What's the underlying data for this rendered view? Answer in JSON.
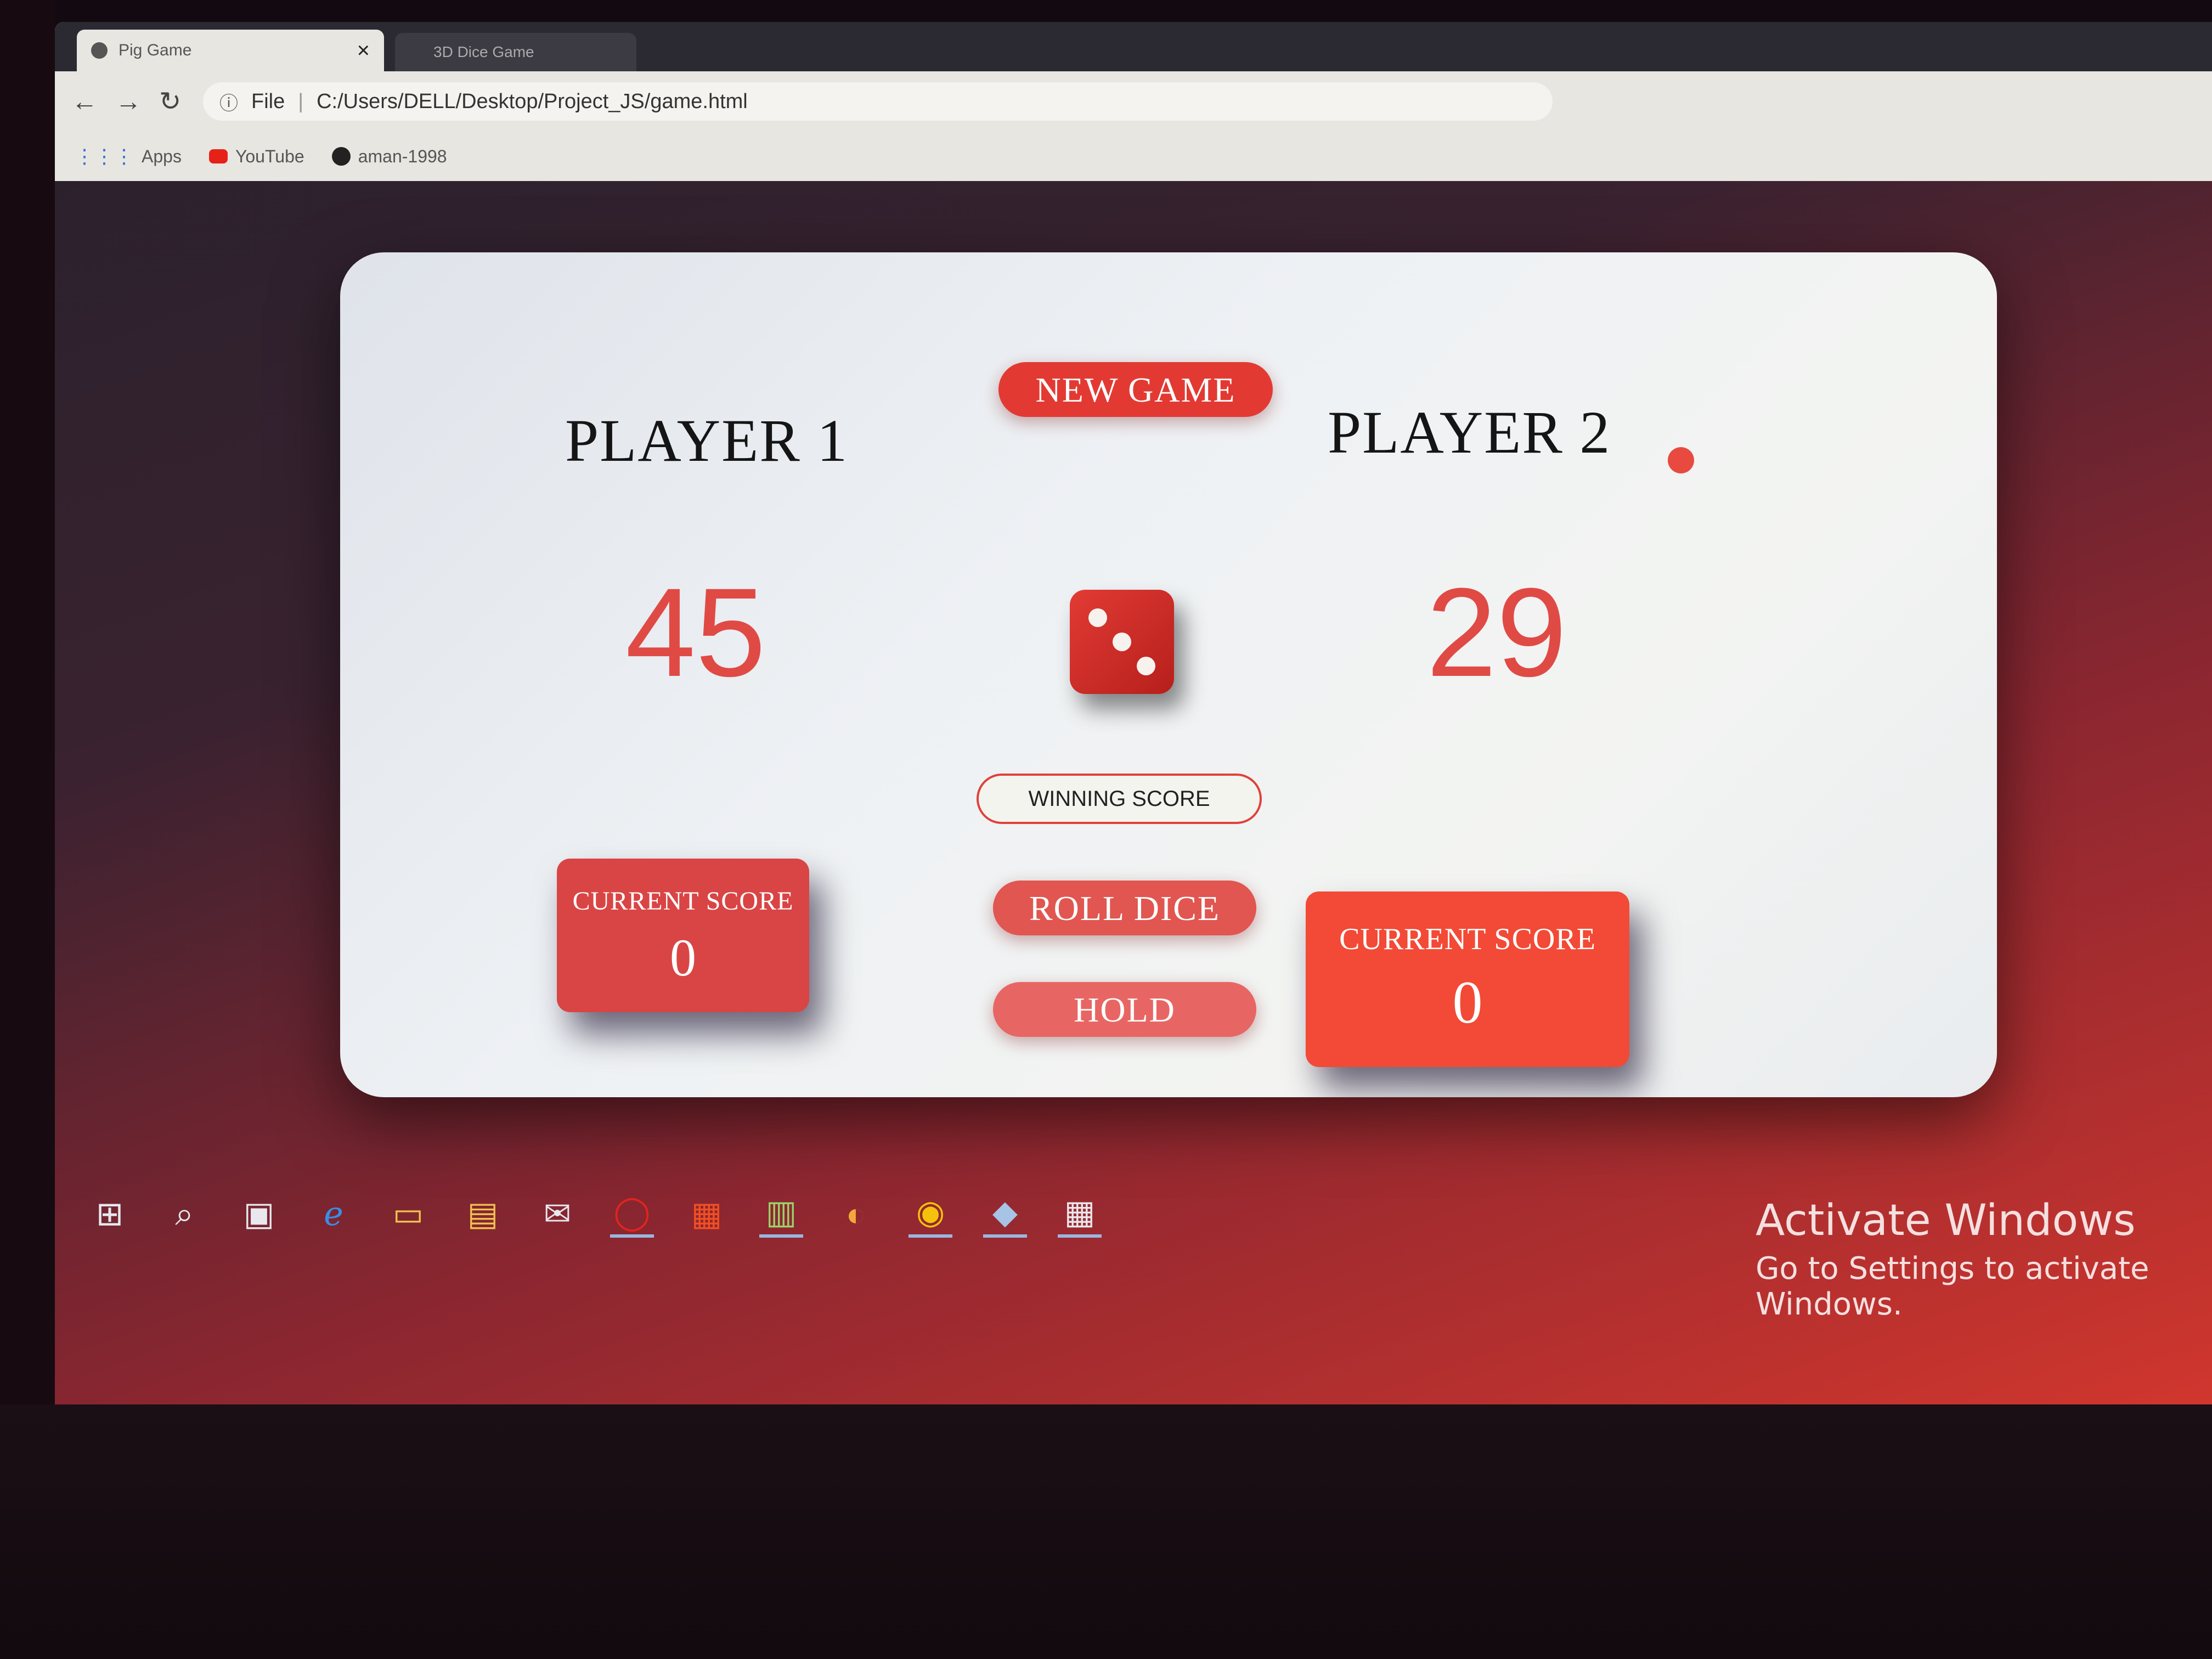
{
  "browser": {
    "tab_title": "Pig Game",
    "tab_close": "×",
    "second_tab_title": "3D Dice Game",
    "url_info": "ⓘ",
    "url_scheme": "File",
    "url_path": "C:/Users/DELL/Desktop/Project_JS/game.html",
    "bookmarks": [
      {
        "label": "Apps",
        "icon": "apps-grid-icon"
      },
      {
        "label": "YouTube",
        "icon": "youtube-icon"
      },
      {
        "label": "aman-1998",
        "icon": "github-icon"
      }
    ]
  },
  "game": {
    "new_game_label": "NEW GAME",
    "player1_name": "PLAYER 1",
    "player2_name": "PLAYER 2",
    "player1_score": "45",
    "player2_score": "29",
    "active_player": 2,
    "dice_value": 3,
    "winning_score_placeholder": "WINNING SCORE",
    "roll_dice_label": "ROLL DICE",
    "hold_label": "HOLD",
    "current_score_label_1": "CURRENT SCORE",
    "current_score_label_2": "CURRENT SCORE",
    "player1_current": "0",
    "player2_current": "0"
  },
  "windows": {
    "activate_title": "Activate Windows",
    "activate_sub": "Go to Settings to activate Windows."
  },
  "colors": {
    "accent_red": "#e0413a",
    "score_red": "#e04a45",
    "current_active": "#f24a36"
  }
}
